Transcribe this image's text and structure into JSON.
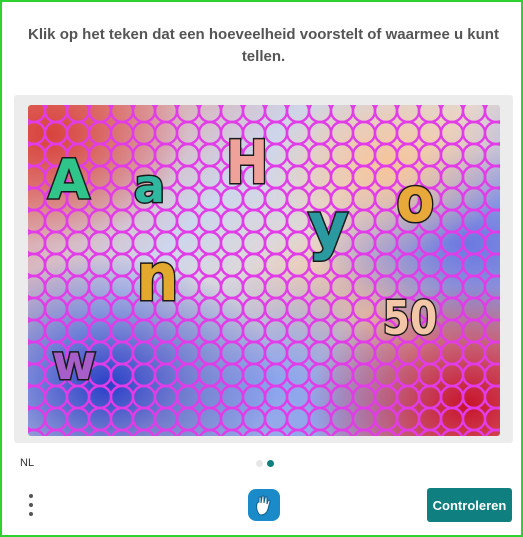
{
  "prompt": "Klik op het teken dat een hoeveelheid voorstelt of waarmee u kunt tellen.",
  "puzzle": {
    "glyphs": {
      "A": "A",
      "a": "a",
      "H": "H",
      "y": "y",
      "o": "o",
      "n": "n",
      "fifty": "50",
      "w": "w"
    },
    "ring_color": "#e23ce8"
  },
  "footer": {
    "language": "NL",
    "page_dots": {
      "total": 2,
      "active": 2
    },
    "menu_icon": "vertical-dots-icon",
    "accessibility_icon": "hand-icon",
    "submit_label": "Controleren"
  },
  "colors": {
    "frame_border": "#2fd12f",
    "accent": "#0f7f7f",
    "prompt_text": "#555555"
  }
}
